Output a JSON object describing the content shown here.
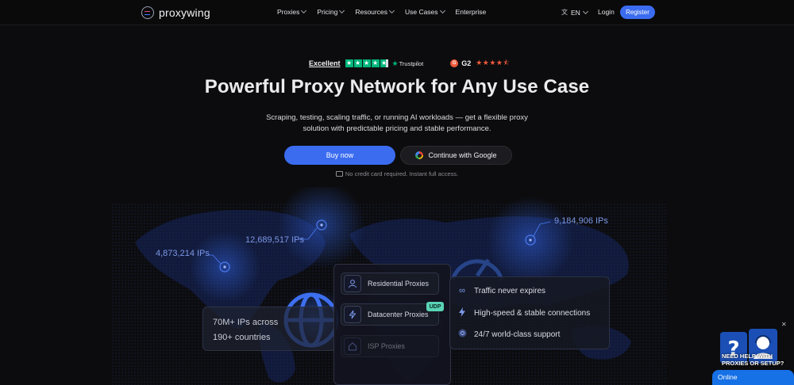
{
  "header": {
    "logo_text": "proxywing",
    "nav": [
      "Proxies",
      "Pricing",
      "Resources",
      "Use Cases",
      "Enterprise"
    ],
    "language": "EN",
    "login_label": "Login",
    "register_label": "Register"
  },
  "ratings": {
    "trustpilot_label": "Excellent",
    "trustpilot_brand": "Trustpilot",
    "g2_label": "G2"
  },
  "hero": {
    "headline": "Powerful Proxy Network for Any Use Case",
    "subtext_line1": "Scraping, testing, scaling traffic, or running AI workloads — get a flexible proxy",
    "subtext_line2": "solution with predictable pricing and stable performance.",
    "buy_label": "Buy now",
    "google_label": "Continue with Google",
    "no_card": "No credit card required. Instant full access."
  },
  "map": {
    "ip_labels": [
      "4,873,214 IPs",
      "12,689,517 IPs",
      "9,184,906 IPs"
    ]
  },
  "stats": {
    "ips": "70M+ IPs across",
    "countries": "190+ countries"
  },
  "products": [
    {
      "label": "Residential Proxies",
      "icon": "user-icon"
    },
    {
      "label": "Datacenter Proxies",
      "icon": "bolt-icon",
      "badge": "UDP"
    },
    {
      "label": "ISP Proxies",
      "icon": "home-icon"
    }
  ],
  "features": [
    {
      "label": "Traffic never expires",
      "icon": "infinity-icon"
    },
    {
      "label": "High-speed & stable connections",
      "icon": "lightning-icon"
    },
    {
      "label": "24/7 world-class support",
      "icon": "support-icon"
    }
  ],
  "help_widget": {
    "title": "NEED HELP WITH PROXIES OR SETUP?",
    "status": "Online"
  },
  "colors": {
    "accent": "#3b6cf0",
    "udp_badge": "#59d3b4",
    "trustpilot": "#00b67a",
    "g2": "#ef5a3c"
  }
}
